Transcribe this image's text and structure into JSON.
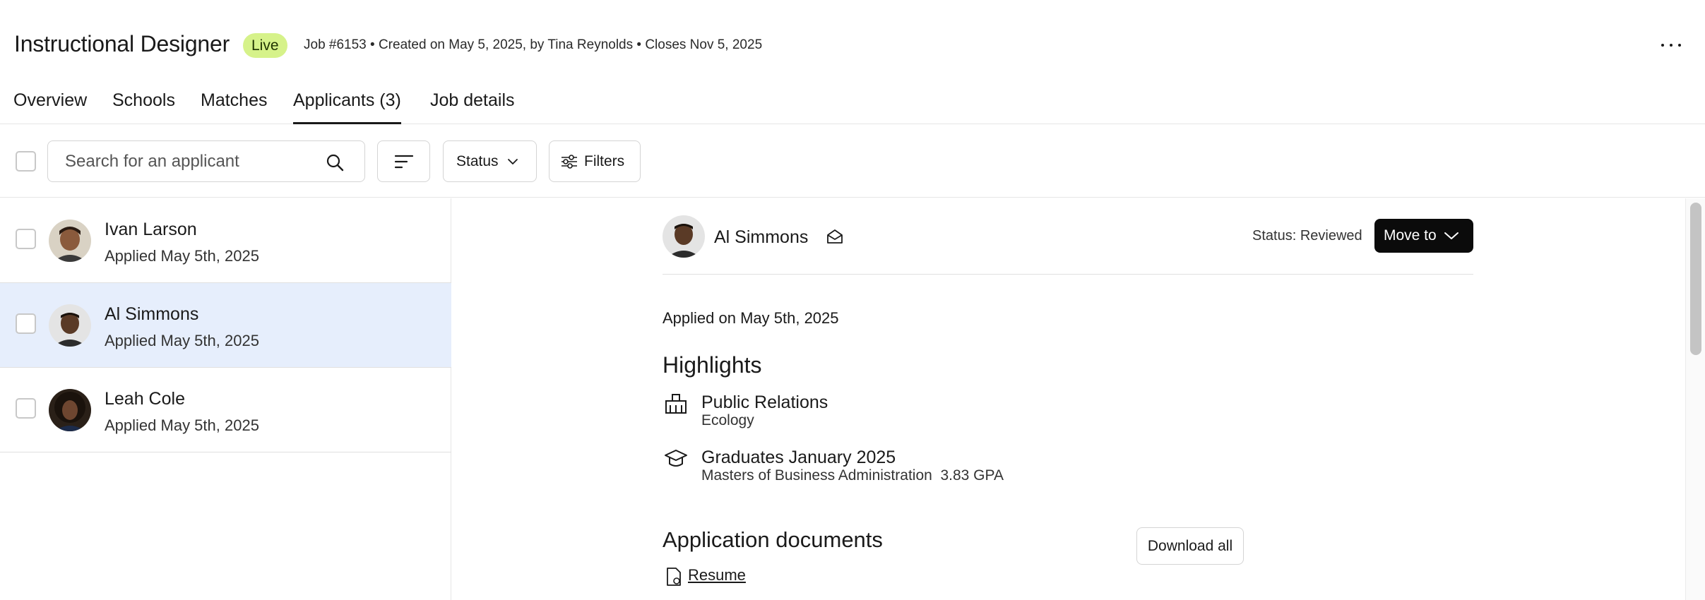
{
  "header": {
    "job_title": "Instructional Designer",
    "status_badge": "Live",
    "meta": "Job #6153 • Created on May 5, 2025, by Tina Reynolds • Closes Nov 5, 2025",
    "more_icon": "more-horizontal-icon"
  },
  "tabs": [
    {
      "label": "Overview",
      "active": false
    },
    {
      "label": "Schools",
      "active": false
    },
    {
      "label": "Matches",
      "active": false
    },
    {
      "label": "Applicants (3)",
      "active": true
    },
    {
      "label": "Job details",
      "active": false
    }
  ],
  "toolbar": {
    "search_placeholder": "Search for an applicant",
    "status_label": "Status",
    "filters_label": "Filters"
  },
  "applicants": [
    {
      "name": "Ivan Larson",
      "applied": "Applied May 5th, 2025",
      "selected": false
    },
    {
      "name": "Al Simmons",
      "applied": "Applied May 5th, 2025",
      "selected": true
    },
    {
      "name": "Leah Cole",
      "applied": "Applied May 5th, 2025",
      "selected": false
    }
  ],
  "detail": {
    "name": "Al Simmons",
    "status": "Status: Reviewed",
    "move_to_label": "Move to",
    "applied_on": "Applied on May 5th, 2025",
    "highlights_title": "Highlights",
    "highlights": [
      {
        "icon": "organization-icon",
        "title": "Public Relations",
        "subtitle": "Ecology"
      },
      {
        "icon": "graduation-cap-icon",
        "title": "Graduates January 2025",
        "subtitle": "Masters of Business Administration  3.83 GPA"
      }
    ],
    "documents_title": "Application documents",
    "download_all_label": "Download all",
    "documents": [
      {
        "icon": "document-icon",
        "label": "Resume"
      }
    ]
  },
  "colors": {
    "live_badge": "#d6f28a",
    "selected_row": "#e6eefc",
    "primary_button": "#0b0b0b"
  }
}
